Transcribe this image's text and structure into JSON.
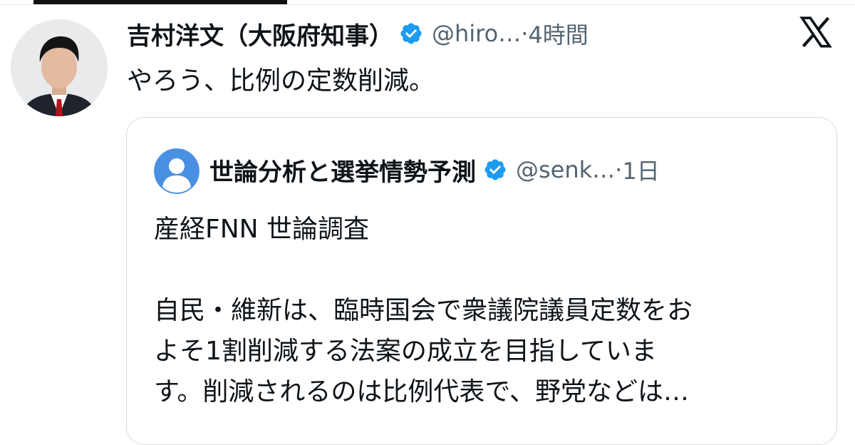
{
  "post": {
    "display_name": "吉村洋文（大阪府知事）",
    "handle": "@hiro…",
    "separator": " · ",
    "time": "4時間",
    "text": "やろう、比例の定数削減。"
  },
  "quoted": {
    "display_name": "世論分析と選挙情勢予測",
    "handle": "@senk…",
    "separator": " · ",
    "time": "1日",
    "lines": [
      "産経FNN 世論調査",
      "",
      "自民・維新は、臨時国会で衆議院議員定数をお",
      "よそ1割削減する法案の成立を目指していま",
      "す。削減されるのは比例代表で、野党などは…"
    ]
  },
  "icons": {
    "verified": "verified-badge-icon",
    "logo": "x-logo-icon",
    "default_avatar": "default-avatar-icon"
  },
  "colors": {
    "verified": "#1d9bf0",
    "secondary_text": "#536471",
    "card_border": "#d6dbdf"
  }
}
